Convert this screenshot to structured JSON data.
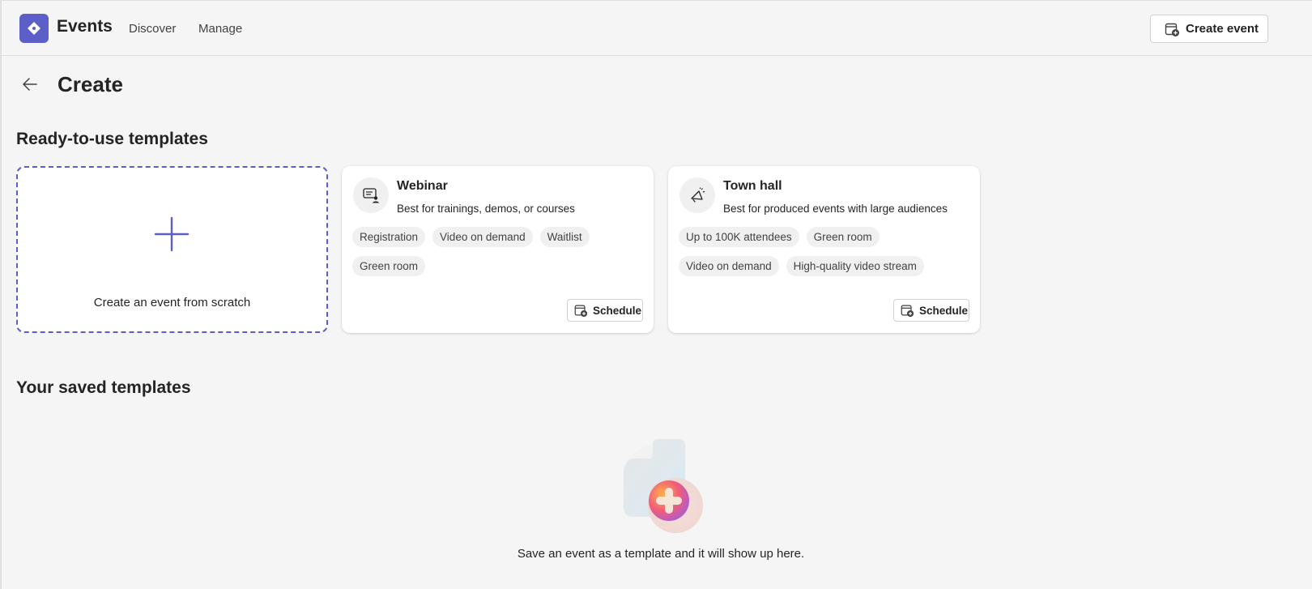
{
  "header": {
    "app_title": "Events",
    "nav": [
      {
        "label": "Discover"
      },
      {
        "label": "Manage"
      }
    ],
    "create_event_label": "Create event"
  },
  "page": {
    "title": "Create"
  },
  "sections": {
    "ready_title": "Ready-to-use templates",
    "saved_title": "Your saved templates"
  },
  "scratch_card": {
    "label": "Create an event from scratch"
  },
  "templates": [
    {
      "name": "Webinar",
      "description": "Best for trainings, demos, or courses",
      "tags": [
        "Registration",
        "Video on demand",
        "Waitlist",
        "Green room"
      ],
      "action_label": "Schedule",
      "icon": "presenter-chat-icon"
    },
    {
      "name": "Town hall",
      "description": "Best for produced events with large audiences",
      "tags": [
        "Up to 100K attendees",
        "Green room",
        "Video on demand",
        "High-quality video stream"
      ],
      "action_label": "Schedule",
      "icon": "megaphone-icon"
    }
  ],
  "empty_state": {
    "message": "Save an event as a template and it will show up here."
  },
  "colors": {
    "brand": "#5b5fc7",
    "background": "#f5f5f5",
    "card": "#ffffff",
    "tag": "#f0f0f0"
  }
}
